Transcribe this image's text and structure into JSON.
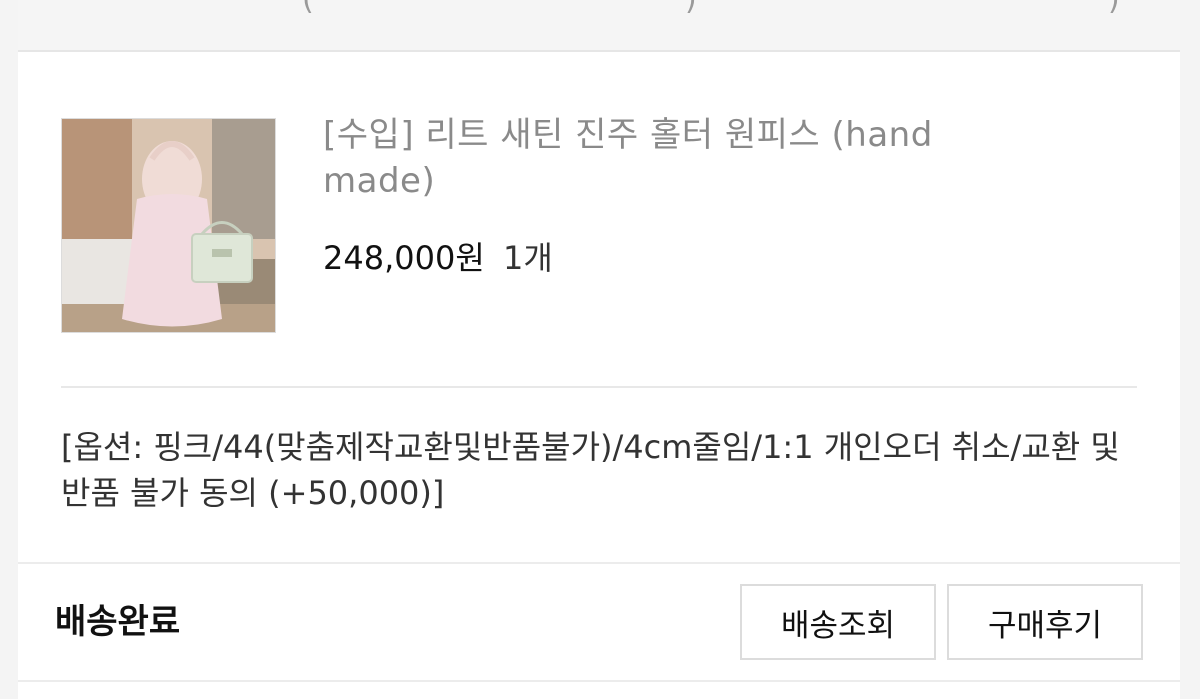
{
  "top_strip": {
    "paren_left": "(",
    "paren_right": ")",
    "paren_far": ")"
  },
  "product": {
    "name": "[수입] 리트 새틴 진주 홀터 원피스 (hand made)",
    "price": "248,000원",
    "quantity": "1개",
    "image_icon": "dress-photo"
  },
  "option_text": "[옵션: 핑크/44(맞춤제작교환및반품불가)/4cm줄임/1:1 개인오더 취소/교환 및 반품 불가 동의 (+50,000)]",
  "order_status": "배송완료",
  "buttons": {
    "track_label": "배송조회",
    "review_label": "구매후기"
  },
  "colors": {
    "price_text": "#111111",
    "name_text": "#8a8a8a",
    "border": "#dcdcdc"
  }
}
